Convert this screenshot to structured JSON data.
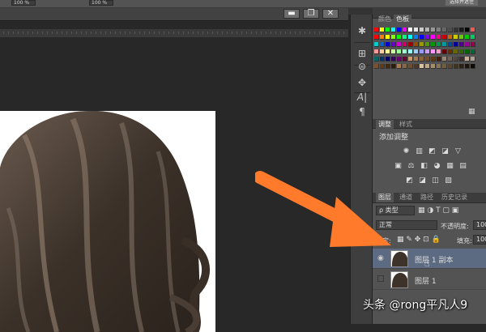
{
  "options_bar": {
    "field1": "100 %",
    "field2": "100 %",
    "right_button": "选择并遮住"
  },
  "window": {
    "buttons": [
      "▬",
      "❐",
      "✕"
    ]
  },
  "icon_strip": [
    "star-icon",
    "layers-icon",
    "move-icon",
    "character-icon",
    "paragraph-icon"
  ],
  "swatch_panel": {
    "tabs": [
      "颜色",
      "色板"
    ],
    "active_tab": 1
  },
  "adjust_panel": {
    "tabs": [
      "调整",
      "样式"
    ],
    "active_tab": 0,
    "label": "添加调整"
  },
  "layers_panel": {
    "tabs": [
      "图层",
      "通道",
      "路径",
      "历史记录"
    ],
    "active_tab": 0,
    "filter_kind": "ρ 类型",
    "blend_mode": "正常",
    "opacity_label": "不透明度:",
    "opacity_value": "100",
    "lock_label": "锁定:",
    "fill_label": "填充:",
    "fill_value": "100",
    "layers": [
      {
        "name": "图层 1 副本",
        "selected": true,
        "visible": true
      },
      {
        "name": "图层 1",
        "selected": false,
        "visible": false
      }
    ]
  },
  "watermark": "头条 @rong平凡人9",
  "colors": {
    "arrow": "#ff7a2a",
    "selected_layer": "#5c6b82",
    "panel_bg": "#535353"
  }
}
